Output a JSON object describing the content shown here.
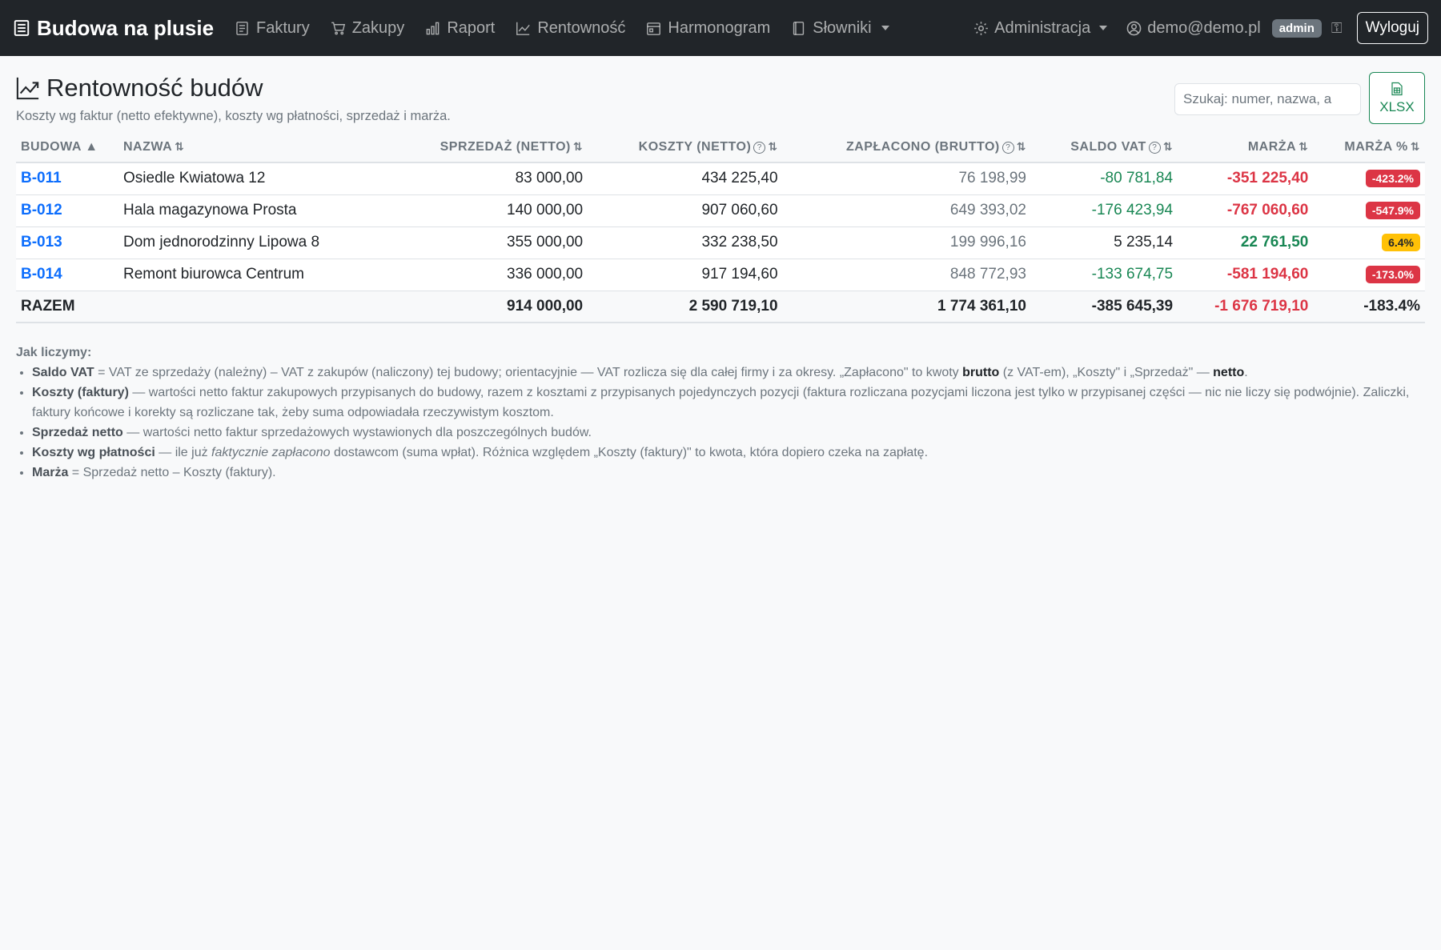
{
  "navbar": {
    "brand": "Budowa na plusie",
    "items": [
      {
        "label": "Faktury",
        "icon": "invoice-icon"
      },
      {
        "label": "Zakupy",
        "icon": "cart-icon"
      },
      {
        "label": "Raport",
        "icon": "bar-chart-icon"
      },
      {
        "label": "Rentowność",
        "icon": "graph-up-icon"
      },
      {
        "label": "Harmonogram",
        "icon": "calendar-icon"
      },
      {
        "label": "Słowniki",
        "icon": "book-icon"
      }
    ],
    "admin_label": "Administracja",
    "user_email": "demo@demo.pl",
    "role_badge": "admin",
    "logout_label": "Wyloguj"
  },
  "page": {
    "title": "Rentowność budów",
    "subtitle": "Koszty wg faktur (netto efektywne), koszty wg płatności, sprzedaż i marża.",
    "search_placeholder": "Szukaj: numer, nazwa, a",
    "export_label": "XLSX"
  },
  "table": {
    "headers": {
      "code": "BUDOWA ▲",
      "name": "NAZWA",
      "sales": "SPRZEDAŻ (NETTO)",
      "costs": "KOSZTY (NETTO)",
      "paid": "ZAPŁACONO (BRUTTO)",
      "vat": "SALDO VAT",
      "margin": "MARŻA",
      "margin_pct": "MARŻA %"
    },
    "rows": [
      {
        "code": "B-011",
        "name": "Osiedle Kwiatowa 12",
        "sales": "83 000,00",
        "costs": "434 225,40",
        "paid": "76 198,99",
        "vat": "-80 781,84",
        "margin": "-351 225,40",
        "margin_pct": "-423.2%"
      },
      {
        "code": "B-012",
        "name": "Hala magazynowa Prosta",
        "sales": "140 000,00",
        "costs": "907 060,60",
        "paid": "649 393,02",
        "vat": "-176 423,94",
        "margin": "-767 060,60",
        "margin_pct": "-547.9%"
      },
      {
        "code": "B-013",
        "name": "Dom jednorodzinny Lipowa 8",
        "sales": "355 000,00",
        "costs": "332 238,50",
        "paid": "199 996,16",
        "vat": "5 235,14",
        "margin": "22 761,50",
        "margin_pct": "6.4%"
      },
      {
        "code": "B-014",
        "name": "Remont biurowca Centrum",
        "sales": "336 000,00",
        "costs": "917 194,60",
        "paid": "848 772,93",
        "vat": "-133 674,75",
        "margin": "-581 194,60",
        "margin_pct": "-173.0%"
      }
    ],
    "total": {
      "label": "RAZEM",
      "sales": "914 000,00",
      "costs": "2 590 719,10",
      "paid": "1 774 361,10",
      "vat": "-385 645,39",
      "margin": "-1 676 719,10",
      "margin_pct": "-183.4%"
    }
  },
  "notes": {
    "title": "Jak liczymy:",
    "vat_term": "Saldo VAT",
    "vat_text_1": " = VAT ze sprzedaży (należny) – VAT z zakupów (naliczony) tej budowy; orientacyjnie — VAT rozlicza się dla całej firmy i za okresy. „Zapłacono\" to kwoty ",
    "vat_brutto": "brutto",
    "vat_text_2": " (z VAT-em), „Koszty\" i „Sprzedaż\" — ",
    "vat_netto": "netto",
    "vat_text_3": ".",
    "costs_term": "Koszty (faktury)",
    "costs_text": " — wartości netto faktur zakupowych przypisanych do budowy, razem z kosztami z przypisanych pojedynczych pozycji (faktura rozliczana pozycjami liczona jest tylko w przypisanej części — nic nie liczy się podwójnie). Zaliczki, faktury końcowe i korekty są rozliczane tak, żeby suma odpowiadała rzeczywistym kosztom.",
    "sales_term": "Sprzedaż netto",
    "sales_text": " — wartości netto faktur sprzedażowych wystawionych dla poszczególnych budów.",
    "payments_term": "Koszty wg płatności",
    "payments_text_1": " — ile już ",
    "payments_italic": "faktycznie zapłacono",
    "payments_text_2": " dostawcom (suma wpłat). Różnica względem „Koszty (faktury)\" to kwota, która dopiero czeka na zapłatę.",
    "margin_term": "Marża",
    "margin_text": " = Sprzedaż netto – Koszty (faktury)."
  }
}
